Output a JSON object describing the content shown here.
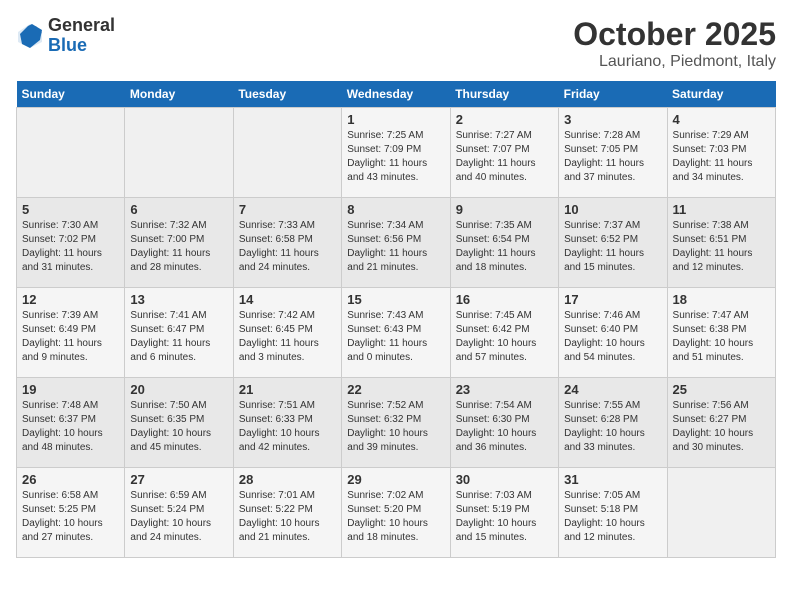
{
  "header": {
    "logo_line1": "General",
    "logo_line2": "Blue",
    "month": "October 2025",
    "location": "Lauriano, Piedmont, Italy"
  },
  "weekdays": [
    "Sunday",
    "Monday",
    "Tuesday",
    "Wednesday",
    "Thursday",
    "Friday",
    "Saturday"
  ],
  "weeks": [
    [
      {
        "day": "",
        "sunrise": "",
        "sunset": "",
        "daylight": ""
      },
      {
        "day": "",
        "sunrise": "",
        "sunset": "",
        "daylight": ""
      },
      {
        "day": "",
        "sunrise": "",
        "sunset": "",
        "daylight": ""
      },
      {
        "day": "1",
        "sunrise": "Sunrise: 7:25 AM",
        "sunset": "Sunset: 7:09 PM",
        "daylight": "Daylight: 11 hours and 43 minutes."
      },
      {
        "day": "2",
        "sunrise": "Sunrise: 7:27 AM",
        "sunset": "Sunset: 7:07 PM",
        "daylight": "Daylight: 11 hours and 40 minutes."
      },
      {
        "day": "3",
        "sunrise": "Sunrise: 7:28 AM",
        "sunset": "Sunset: 7:05 PM",
        "daylight": "Daylight: 11 hours and 37 minutes."
      },
      {
        "day": "4",
        "sunrise": "Sunrise: 7:29 AM",
        "sunset": "Sunset: 7:03 PM",
        "daylight": "Daylight: 11 hours and 34 minutes."
      }
    ],
    [
      {
        "day": "5",
        "sunrise": "Sunrise: 7:30 AM",
        "sunset": "Sunset: 7:02 PM",
        "daylight": "Daylight: 11 hours and 31 minutes."
      },
      {
        "day": "6",
        "sunrise": "Sunrise: 7:32 AM",
        "sunset": "Sunset: 7:00 PM",
        "daylight": "Daylight: 11 hours and 28 minutes."
      },
      {
        "day": "7",
        "sunrise": "Sunrise: 7:33 AM",
        "sunset": "Sunset: 6:58 PM",
        "daylight": "Daylight: 11 hours and 24 minutes."
      },
      {
        "day": "8",
        "sunrise": "Sunrise: 7:34 AM",
        "sunset": "Sunset: 6:56 PM",
        "daylight": "Daylight: 11 hours and 21 minutes."
      },
      {
        "day": "9",
        "sunrise": "Sunrise: 7:35 AM",
        "sunset": "Sunset: 6:54 PM",
        "daylight": "Daylight: 11 hours and 18 minutes."
      },
      {
        "day": "10",
        "sunrise": "Sunrise: 7:37 AM",
        "sunset": "Sunset: 6:52 PM",
        "daylight": "Daylight: 11 hours and 15 minutes."
      },
      {
        "day": "11",
        "sunrise": "Sunrise: 7:38 AM",
        "sunset": "Sunset: 6:51 PM",
        "daylight": "Daylight: 11 hours and 12 minutes."
      }
    ],
    [
      {
        "day": "12",
        "sunrise": "Sunrise: 7:39 AM",
        "sunset": "Sunset: 6:49 PM",
        "daylight": "Daylight: 11 hours and 9 minutes."
      },
      {
        "day": "13",
        "sunrise": "Sunrise: 7:41 AM",
        "sunset": "Sunset: 6:47 PM",
        "daylight": "Daylight: 11 hours and 6 minutes."
      },
      {
        "day": "14",
        "sunrise": "Sunrise: 7:42 AM",
        "sunset": "Sunset: 6:45 PM",
        "daylight": "Daylight: 11 hours and 3 minutes."
      },
      {
        "day": "15",
        "sunrise": "Sunrise: 7:43 AM",
        "sunset": "Sunset: 6:43 PM",
        "daylight": "Daylight: 11 hours and 0 minutes."
      },
      {
        "day": "16",
        "sunrise": "Sunrise: 7:45 AM",
        "sunset": "Sunset: 6:42 PM",
        "daylight": "Daylight: 10 hours and 57 minutes."
      },
      {
        "day": "17",
        "sunrise": "Sunrise: 7:46 AM",
        "sunset": "Sunset: 6:40 PM",
        "daylight": "Daylight: 10 hours and 54 minutes."
      },
      {
        "day": "18",
        "sunrise": "Sunrise: 7:47 AM",
        "sunset": "Sunset: 6:38 PM",
        "daylight": "Daylight: 10 hours and 51 minutes."
      }
    ],
    [
      {
        "day": "19",
        "sunrise": "Sunrise: 7:48 AM",
        "sunset": "Sunset: 6:37 PM",
        "daylight": "Daylight: 10 hours and 48 minutes."
      },
      {
        "day": "20",
        "sunrise": "Sunrise: 7:50 AM",
        "sunset": "Sunset: 6:35 PM",
        "daylight": "Daylight: 10 hours and 45 minutes."
      },
      {
        "day": "21",
        "sunrise": "Sunrise: 7:51 AM",
        "sunset": "Sunset: 6:33 PM",
        "daylight": "Daylight: 10 hours and 42 minutes."
      },
      {
        "day": "22",
        "sunrise": "Sunrise: 7:52 AM",
        "sunset": "Sunset: 6:32 PM",
        "daylight": "Daylight: 10 hours and 39 minutes."
      },
      {
        "day": "23",
        "sunrise": "Sunrise: 7:54 AM",
        "sunset": "Sunset: 6:30 PM",
        "daylight": "Daylight: 10 hours and 36 minutes."
      },
      {
        "day": "24",
        "sunrise": "Sunrise: 7:55 AM",
        "sunset": "Sunset: 6:28 PM",
        "daylight": "Daylight: 10 hours and 33 minutes."
      },
      {
        "day": "25",
        "sunrise": "Sunrise: 7:56 AM",
        "sunset": "Sunset: 6:27 PM",
        "daylight": "Daylight: 10 hours and 30 minutes."
      }
    ],
    [
      {
        "day": "26",
        "sunrise": "Sunrise: 6:58 AM",
        "sunset": "Sunset: 5:25 PM",
        "daylight": "Daylight: 10 hours and 27 minutes."
      },
      {
        "day": "27",
        "sunrise": "Sunrise: 6:59 AM",
        "sunset": "Sunset: 5:24 PM",
        "daylight": "Daylight: 10 hours and 24 minutes."
      },
      {
        "day": "28",
        "sunrise": "Sunrise: 7:01 AM",
        "sunset": "Sunset: 5:22 PM",
        "daylight": "Daylight: 10 hours and 21 minutes."
      },
      {
        "day": "29",
        "sunrise": "Sunrise: 7:02 AM",
        "sunset": "Sunset: 5:20 PM",
        "daylight": "Daylight: 10 hours and 18 minutes."
      },
      {
        "day": "30",
        "sunrise": "Sunrise: 7:03 AM",
        "sunset": "Sunset: 5:19 PM",
        "daylight": "Daylight: 10 hours and 15 minutes."
      },
      {
        "day": "31",
        "sunrise": "Sunrise: 7:05 AM",
        "sunset": "Sunset: 5:18 PM",
        "daylight": "Daylight: 10 hours and 12 minutes."
      },
      {
        "day": "",
        "sunrise": "",
        "sunset": "",
        "daylight": ""
      }
    ]
  ]
}
